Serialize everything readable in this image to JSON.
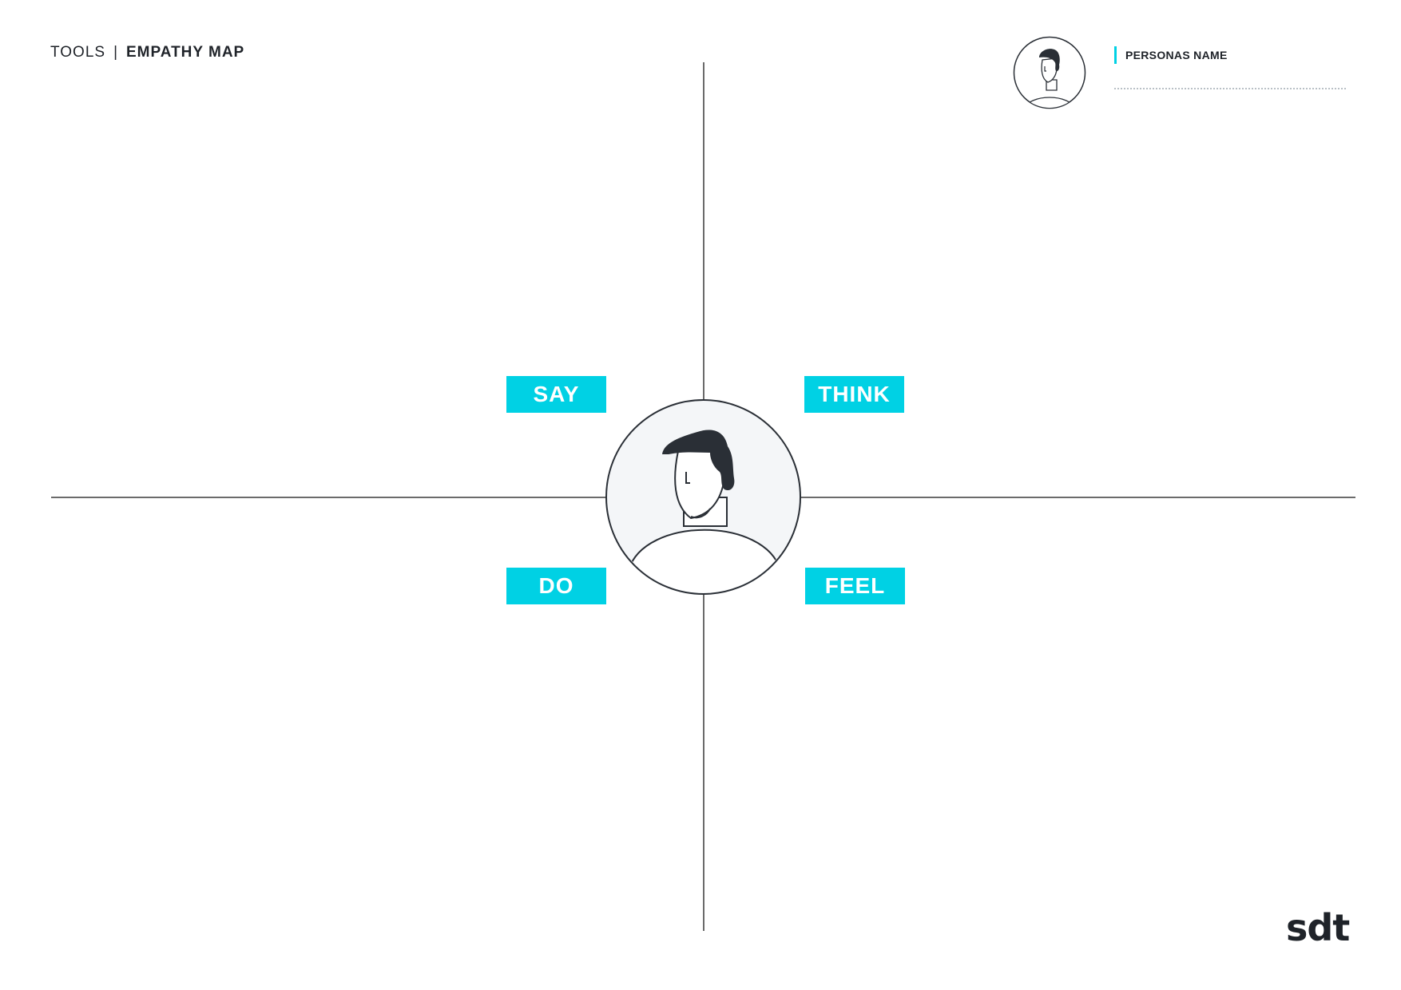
{
  "header": {
    "section": "TOOLS",
    "separator": "|",
    "title": "EMPATHY MAP"
  },
  "persona": {
    "name_label": "PERSONAS NAME"
  },
  "quadrants": {
    "say": "SAY",
    "think": "THINK",
    "do": "DO",
    "feel": "FEEL"
  },
  "logo": "sdt",
  "colors": {
    "accent": "#00d1e4",
    "ink": "#2a2f36",
    "avatar_bg": "#f4f6f8",
    "axis": "#6b6b6b"
  },
  "icons": {
    "persona_avatar": "person-avatar-icon",
    "center_avatar": "person-avatar-icon"
  }
}
